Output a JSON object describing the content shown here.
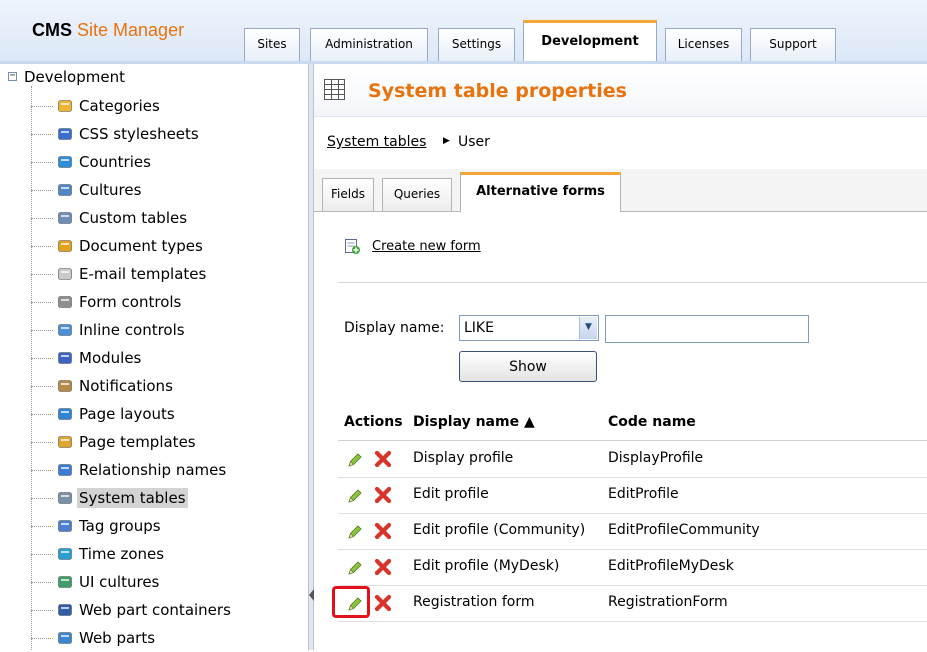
{
  "app": {
    "logo_bold": "CMS",
    "logo_rest": "Site Manager"
  },
  "top_tabs": [
    {
      "label": "Sites",
      "active": false
    },
    {
      "label": "Administration",
      "active": false
    },
    {
      "label": "Settings",
      "active": false
    },
    {
      "label": "Development",
      "active": true
    },
    {
      "label": "Licenses",
      "active": false
    },
    {
      "label": "Support",
      "active": false
    }
  ],
  "tree": {
    "expander": "−",
    "root": "Development",
    "items": [
      {
        "label": "Categories",
        "icon": "categories-icon",
        "selected": false
      },
      {
        "label": "CSS stylesheets",
        "icon": "css-stylesheets-icon",
        "selected": false
      },
      {
        "label": "Countries",
        "icon": "countries-icon",
        "selected": false
      },
      {
        "label": "Cultures",
        "icon": "cultures-icon",
        "selected": false
      },
      {
        "label": "Custom tables",
        "icon": "custom-tables-icon",
        "selected": false
      },
      {
        "label": "Document types",
        "icon": "document-types-icon",
        "selected": false
      },
      {
        "label": "E-mail templates",
        "icon": "email-templates-icon",
        "selected": false
      },
      {
        "label": "Form controls",
        "icon": "form-controls-icon",
        "selected": false
      },
      {
        "label": "Inline controls",
        "icon": "inline-controls-icon",
        "selected": false
      },
      {
        "label": "Modules",
        "icon": "modules-icon",
        "selected": false
      },
      {
        "label": "Notifications",
        "icon": "notifications-icon",
        "selected": false
      },
      {
        "label": "Page layouts",
        "icon": "page-layouts-icon",
        "selected": false
      },
      {
        "label": "Page templates",
        "icon": "page-templates-icon",
        "selected": false
      },
      {
        "label": "Relationship names",
        "icon": "relationship-names-icon",
        "selected": false
      },
      {
        "label": "System tables",
        "icon": "system-tables-icon",
        "selected": true
      },
      {
        "label": "Tag groups",
        "icon": "tag-groups-icon",
        "selected": false
      },
      {
        "label": "Time zones",
        "icon": "time-zones-icon",
        "selected": false
      },
      {
        "label": "UI cultures",
        "icon": "ui-cultures-icon",
        "selected": false
      },
      {
        "label": "Web part containers",
        "icon": "web-part-containers-icon",
        "selected": false
      },
      {
        "label": "Web parts",
        "icon": "web-parts-icon",
        "selected": false
      }
    ]
  },
  "page": {
    "title": "System table properties",
    "breadcrumb": {
      "link": "System tables",
      "separator": "▶",
      "current": "User"
    },
    "subtabs": [
      {
        "label": "Fields",
        "active": false
      },
      {
        "label": "Queries",
        "active": false
      },
      {
        "label": "Alternative forms",
        "active": true
      }
    ],
    "create_link": "Create new form",
    "filter": {
      "label": "Display name:",
      "operator": "LIKE",
      "dropdown_arrow": "▼",
      "value": "",
      "show_button": "Show"
    },
    "grid": {
      "headers": {
        "actions": "Actions",
        "display_name": "Display name ▲",
        "code_name": "Code name"
      },
      "rows": [
        {
          "display_name": "Display profile",
          "code_name": "DisplayProfile"
        },
        {
          "display_name": "Edit profile",
          "code_name": "EditProfile"
        },
        {
          "display_name": "Edit profile (Community)",
          "code_name": "EditProfileCommunity"
        },
        {
          "display_name": "Edit profile (MyDesk)",
          "code_name": "EditProfileMyDesk"
        },
        {
          "display_name": "Registration form",
          "code_name": "RegistrationForm",
          "highlighted_action": "edit"
        }
      ]
    }
  },
  "colors": {
    "accent_orange": "#e8720c",
    "tab_active_border": "#f5a531",
    "highlight_red": "#e2121d",
    "header_bg": "#dbe7f7"
  }
}
